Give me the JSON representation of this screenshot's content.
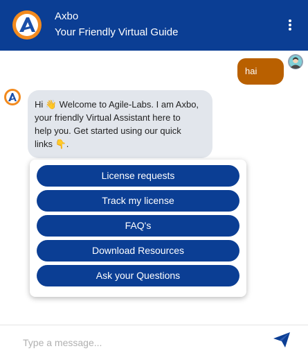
{
  "header": {
    "title": "Axbo",
    "subtitle": "Your Friendly Virtual Guide",
    "menu_icon": "kebab-menu-icon",
    "logo_icon": "axbo-logo-icon"
  },
  "colors": {
    "brand_blue": "#0b3e94",
    "user_bubble": "#b96000",
    "bot_bubble": "#e2e6ec",
    "logo_orange": "#f28a1e"
  },
  "conversation": {
    "user_message": "hai",
    "bot_message": {
      "line1": "Hi 👋 Welcome to Agile-Labs. I am Axbo,",
      "line2": "your friendly Virtual Assistant here to",
      "line3": "help you. Get started using our quick",
      "line4": "links 👇."
    }
  },
  "quick_links": [
    "License requests",
    "Track my license",
    "FAQ's",
    "Download Resources",
    "Ask your Questions"
  ],
  "composer": {
    "placeholder": "Type a message...",
    "send_icon": "send-icon"
  }
}
